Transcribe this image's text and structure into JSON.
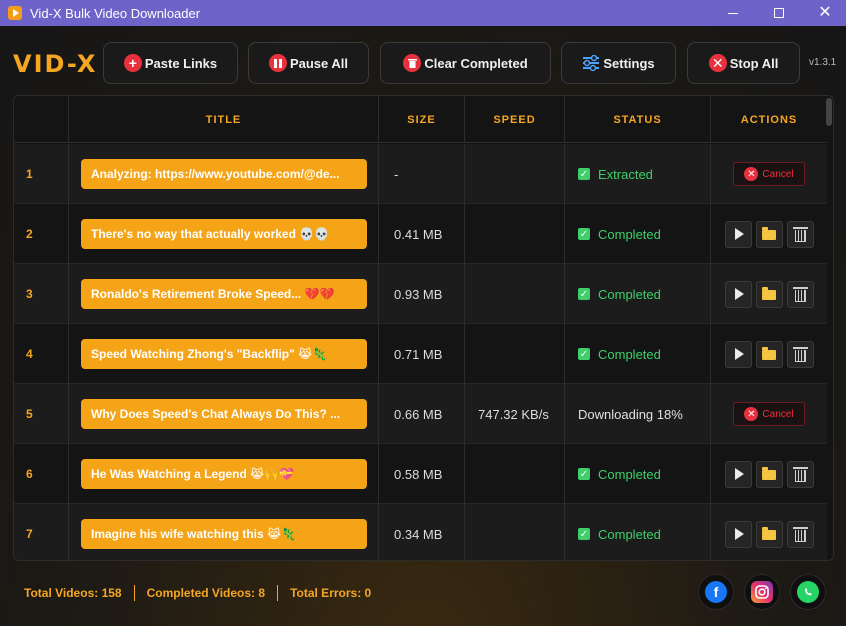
{
  "window": {
    "title": "Vid-X Bulk Video Downloader"
  },
  "app": {
    "logo": "VID-X",
    "version": "v1.3.1"
  },
  "toolbar": {
    "paste_label": "Paste Links",
    "pause_label": "Pause All",
    "clear_label": "Clear Completed",
    "settings_label": "Settings",
    "stop_label": "Stop All"
  },
  "table": {
    "headers": {
      "title": "TITLE",
      "size": "SIZE",
      "speed": "SPEED",
      "status": "STATUS",
      "actions": "ACTIONS"
    },
    "rows": [
      {
        "num": "1",
        "title": "Analyzing: https://www.youtube.com/@de...",
        "size": "-",
        "speed": "",
        "status": "Extracted",
        "state": "extracted",
        "action": "Cancel"
      },
      {
        "num": "2",
        "title": "There's no way that actually worked 💀💀",
        "size": "0.41 MB",
        "speed": "",
        "status": "Completed",
        "state": "completed",
        "action": ""
      },
      {
        "num": "3",
        "title": "Ronaldo's Retirement Broke Speed... 💔💔",
        "size": "0.93 MB",
        "speed": "",
        "status": "Completed",
        "state": "completed",
        "action": ""
      },
      {
        "num": "4",
        "title": "Speed Watching Zhong's \"Backflip\" 😹🦎",
        "size": "0.71 MB",
        "speed": "",
        "status": "Completed",
        "state": "completed",
        "action": ""
      },
      {
        "num": "5",
        "title": "Why Does Speed's Chat Always Do This? ...",
        "size": "0.66 MB",
        "speed": "747.32 KB/s",
        "status": "Downloading 18%",
        "state": "downloading",
        "action": "Cancel"
      },
      {
        "num": "6",
        "title": "He Was Watching a Legend 😹🙌💝",
        "size": "0.58 MB",
        "speed": "",
        "status": "Completed",
        "state": "completed",
        "action": ""
      },
      {
        "num": "7",
        "title": "Imagine his wife watching this 😹🦎",
        "size": "0.34 MB",
        "speed": "",
        "status": "Completed",
        "state": "completed",
        "action": ""
      }
    ]
  },
  "footer": {
    "total_videos": "Total Videos: 158",
    "completed_videos": "Completed Videos: 8",
    "total_errors": "Total Errors: 0"
  },
  "social": [
    "facebook-icon",
    "instagram-icon",
    "whatsapp-icon"
  ],
  "colors": {
    "accent": "#f5a623",
    "titlebar": "#6e63c9",
    "success": "#3fcf6a",
    "danger": "#e8313d"
  }
}
